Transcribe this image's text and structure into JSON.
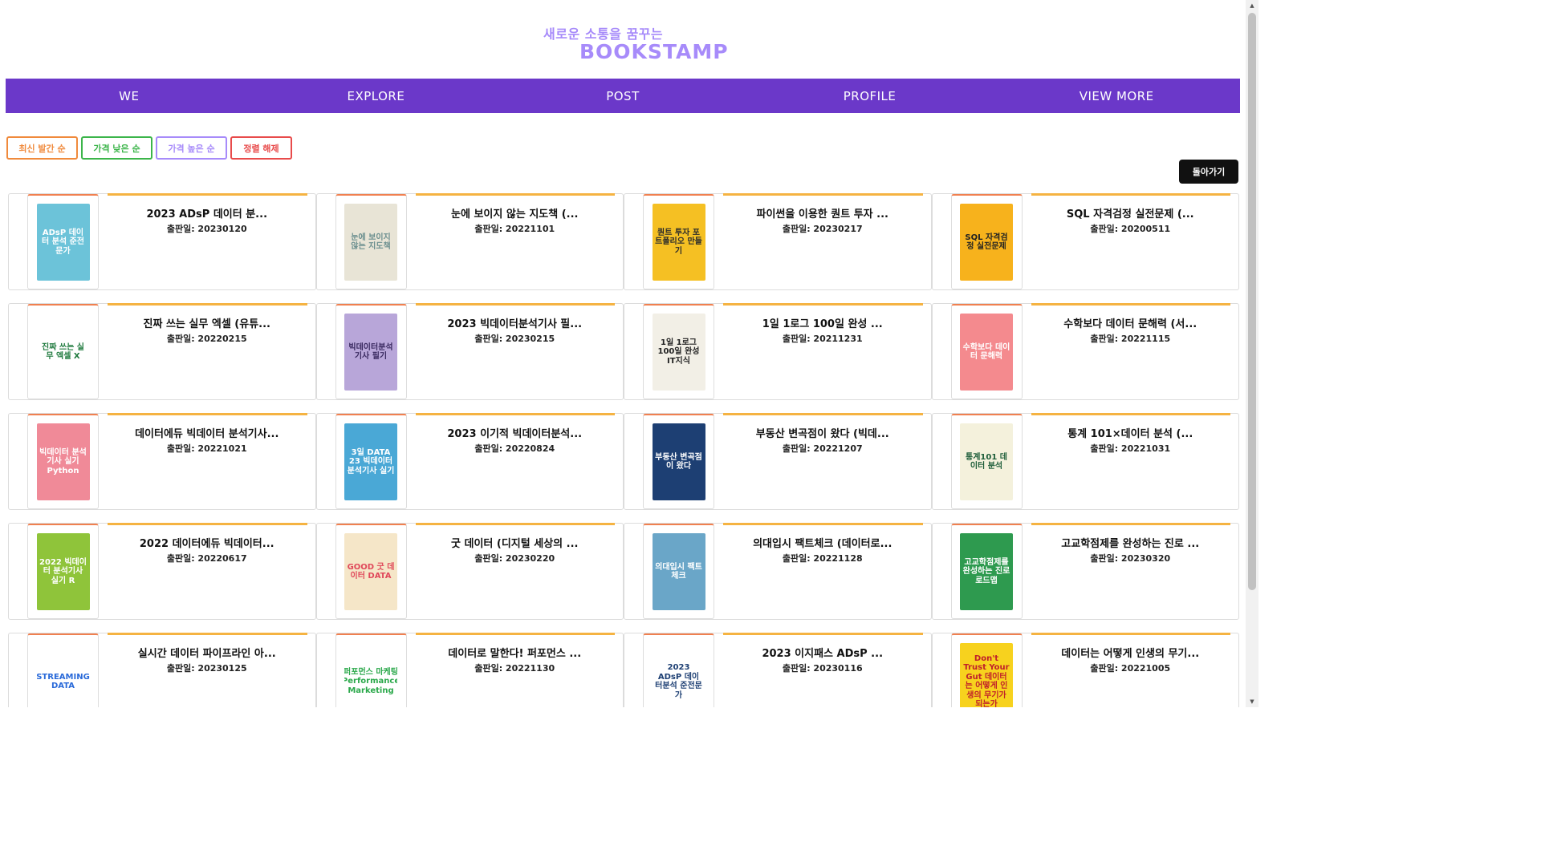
{
  "header": {
    "tagline": "새로운 소통을 꿈꾸는",
    "logo": "BOOKSTAMP"
  },
  "nav": {
    "items": [
      "WE",
      "EXPLORE",
      "POST",
      "PROFILE",
      "VIEW MORE"
    ]
  },
  "sort": {
    "buttons": [
      {
        "label": "최신 발간 순",
        "color": "#f08a3c"
      },
      {
        "label": "가격 낮은 순",
        "color": "#3cb54a"
      },
      {
        "label": "가격 높은 순",
        "color": "#a78bfa"
      },
      {
        "label": "정렬 해제",
        "color": "#e84b4b"
      }
    ]
  },
  "back_button": "돌아가기",
  "books": [
    {
      "title": "2023 ADsP 데이터 분...",
      "date": "출판일: 20230120",
      "cover_text": "ADsP 데이터 분석 준전문가",
      "cover_bg": "#6cc3d9",
      "cover_fg": "#ffffff"
    },
    {
      "title": "눈에 보이지 않는 지도책 (...",
      "date": "출판일: 20221101",
      "cover_text": "눈에 보이지 않는 지도책",
      "cover_bg": "#e8e4d6",
      "cover_fg": "#6b8f8f"
    },
    {
      "title": "파이썬을 이용한 퀀트 투자 ...",
      "date": "출판일: 20230217",
      "cover_text": "퀀트 투자 포트폴리오 만들기",
      "cover_bg": "#f5c023",
      "cover_fg": "#2b2b2b"
    },
    {
      "title": "SQL 자격검정 실전문제 (...",
      "date": "출판일: 20200511",
      "cover_text": "SQL 자격검정 실전문제",
      "cover_bg": "#f7b21c",
      "cover_fg": "#222222"
    },
    {
      "title": "진짜 쓰는 실무 엑셀 (유튜...",
      "date": "출판일: 20220215",
      "cover_text": "진짜 쓰는 실무 엑셀 X",
      "cover_bg": "#ffffff",
      "cover_fg": "#1f7a3e"
    },
    {
      "title": "2023 빅데이터분석기사 필...",
      "date": "출판일: 20230215",
      "cover_text": "빅데이터분석기사 필기",
      "cover_bg": "#b8a6d9",
      "cover_fg": "#3a2a60"
    },
    {
      "title": "1일 1로그 100일 완성 ...",
      "date": "출판일: 20211231",
      "cover_text": "1일 1로그 100일 완성 IT지식",
      "cover_bg": "#f2efe6",
      "cover_fg": "#222222"
    },
    {
      "title": "수학보다 데이터 문해력 (서...",
      "date": "출판일: 20221115",
      "cover_text": "수학보다 데이터 문해력",
      "cover_bg": "#f48a8e",
      "cover_fg": "#ffffff"
    },
    {
      "title": "데이터에듀 빅데이터 분석기사...",
      "date": "출판일: 20221021",
      "cover_text": "빅데이터 분석기사 실기 Python",
      "cover_bg": "#f08a98",
      "cover_fg": "#ffffff"
    },
    {
      "title": "2023 이기적 빅데이터분석...",
      "date": "출판일: 20220824",
      "cover_text": "3일 DATA 23 빅데이터 분석기사 실기",
      "cover_bg": "#4aa8d6",
      "cover_fg": "#ffffff"
    },
    {
      "title": "부동산 변곡점이 왔다 (빅데...",
      "date": "출판일: 20221207",
      "cover_text": "부동산 변곡점이 왔다",
      "cover_bg": "#1d3f73",
      "cover_fg": "#ffffff"
    },
    {
      "title": "통계 101×데이터 분석 (...",
      "date": "출판일: 20221031",
      "cover_text": "통계101 데이터 분석",
      "cover_bg": "#f4f1dc",
      "cover_fg": "#1e5e3a"
    },
    {
      "title": "2022 데이터에듀 빅데이터...",
      "date": "출판일: 20220617",
      "cover_text": "2022 빅데이터 분석기사 실기 R",
      "cover_bg": "#8fc43a",
      "cover_fg": "#ffffff"
    },
    {
      "title": "굿 데이터 (디지털 세상의 ...",
      "date": "출판일: 20230220",
      "cover_text": "GOOD 굿 데이터 DATA",
      "cover_bg": "#f5e6c8",
      "cover_fg": "#e0485a"
    },
    {
      "title": "의대입시 팩트체크 (데이터로...",
      "date": "출판일: 20221128",
      "cover_text": "의대입시 팩트체크",
      "cover_bg": "#6aa6c8",
      "cover_fg": "#ffffff"
    },
    {
      "title": "고교학점제를 완성하는 진로 ...",
      "date": "출판일: 20230320",
      "cover_text": "고교학점제를 완성하는 진로 로드맵",
      "cover_bg": "#2e9a4f",
      "cover_fg": "#ffffff"
    },
    {
      "title": "실시간 데이터 파이프라인 아...",
      "date": "출판일: 20230125",
      "cover_text": "STREAMING DATA",
      "cover_bg": "#ffffff",
      "cover_fg": "#2a6ad9"
    },
    {
      "title": "데이터로 말한다! 퍼포먼스 ...",
      "date": "출판일: 20221130",
      "cover_text": "퍼포먼스 마케팅 Performance Marketing",
      "cover_bg": "#ffffff",
      "cover_fg": "#2aa84a"
    },
    {
      "title": "2023 이지패스 ADsP ...",
      "date": "출판일: 20230116",
      "cover_text": "2023 ADsP 데이터분석 준전문가",
      "cover_bg": "#ffffff",
      "cover_fg": "#1d3f73"
    },
    {
      "title": "데이터는 어떻게 인생의 무기...",
      "date": "출판일: 20221005",
      "cover_text": "Don't Trust Your Gut 데이터는 어떻게 인생의 무기가 되는가",
      "cover_bg": "#f7d21e",
      "cover_fg": "#c0202a"
    }
  ]
}
